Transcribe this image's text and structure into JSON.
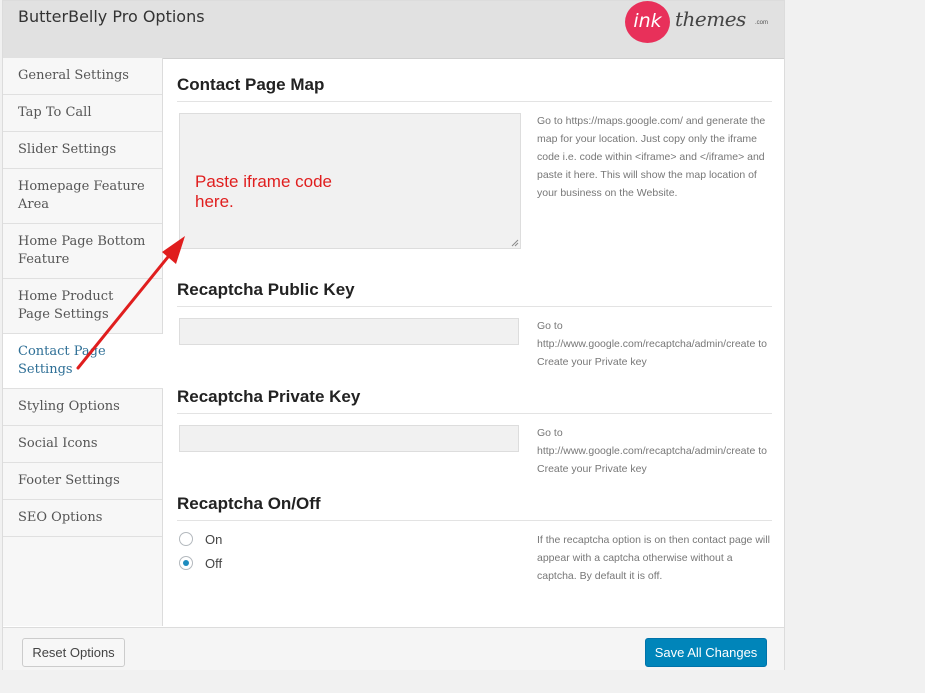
{
  "header": {
    "title": "ButterBelly Pro Options"
  },
  "logo": {
    "mark": "ink",
    "word": "themes",
    "suffix": ".com"
  },
  "sidebar": {
    "items": [
      {
        "label": "General Settings"
      },
      {
        "label": "Tap To Call"
      },
      {
        "label": "Slider Settings"
      },
      {
        "label": "Homepage Feature Area"
      },
      {
        "label": "Home Page Bottom Feature"
      },
      {
        "label": "Home Product Page Settings"
      },
      {
        "label": "Contact Page Settings",
        "active": true
      },
      {
        "label": "Styling Options"
      },
      {
        "label": "Social Icons"
      },
      {
        "label": "Footer Settings"
      },
      {
        "label": "SEO Options"
      }
    ]
  },
  "sections": {
    "map": {
      "title": "Contact Page Map",
      "value": "",
      "description": "Go to https://maps.google.com/ and generate the map for your location. Just copy only the iframe code i.e. code within <iframe> and </iframe> and paste it here. This will show the map location of your business on the Website."
    },
    "public_key": {
      "title": "Recaptcha Public Key",
      "value": "",
      "description": "Go to http://www.google.com/recaptcha/admin/create to Create your Private key"
    },
    "private_key": {
      "title": "Recaptcha Private Key",
      "value": "",
      "description": "Go to http://www.google.com/recaptcha/admin/create to Create your Private key"
    },
    "onoff": {
      "title": "Recaptcha On/Off",
      "options": [
        {
          "label": "On",
          "checked": false
        },
        {
          "label": "Off",
          "checked": true
        }
      ],
      "description": "If the recaptcha option is on then contact page will appear with a captcha otherwise without a captcha. By default it is off."
    }
  },
  "annotation": {
    "text": "Paste iframe code here.",
    "color": "#e01e1e"
  },
  "footer": {
    "reset_label": "Reset Options",
    "save_label": "Save All Changes"
  },
  "colors": {
    "accent": "#0085ba",
    "active_nav": "#2e6f96",
    "logo": "#e8305a"
  }
}
